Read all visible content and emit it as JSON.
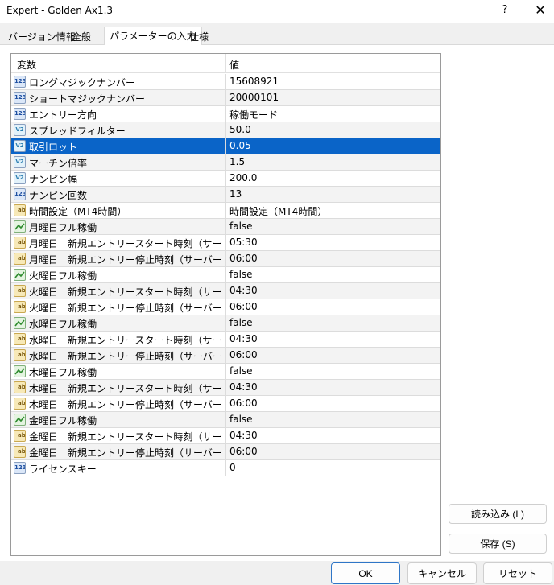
{
  "window": {
    "title": "Expert - Golden Ax1.3",
    "help_glyph": "?",
    "close_glyph": "✕"
  },
  "tabs": [
    {
      "label": "バージョン情報",
      "active": false
    },
    {
      "label": "全般",
      "active": false
    },
    {
      "label": "パラメーターの入力",
      "active": true
    },
    {
      "label": "仕様",
      "active": false
    }
  ],
  "grid": {
    "col_variable": "変数",
    "col_value": "値",
    "rows": [
      {
        "type": "123",
        "name": "ロングマジックナンバー",
        "value": "15608921"
      },
      {
        "type": "123",
        "name": "ショートマジックナンバー",
        "value": "20000101"
      },
      {
        "type": "123",
        "name": "エントリー方向",
        "value": "稼働モード"
      },
      {
        "type": "v2",
        "name": "スプレッドフィルター",
        "value": "50.0"
      },
      {
        "type": "v2",
        "name": "取引ロット",
        "value": "0.05",
        "selected": true
      },
      {
        "type": "v2",
        "name": "マーチン倍率",
        "value": "1.5"
      },
      {
        "type": "v2",
        "name": "ナンピン幅",
        "value": "200.0"
      },
      {
        "type": "123",
        "name": "ナンピン回数",
        "value": "13"
      },
      {
        "type": "ab",
        "name": "時間設定（MT4時間）",
        "value": "時間設定（MT4時間）"
      },
      {
        "type": "bool",
        "name": "月曜日フル稼働",
        "value": "false"
      },
      {
        "type": "ab",
        "name": "月曜日　新規エントリースタート時刻（サーバー時…",
        "value": "05:30"
      },
      {
        "type": "ab",
        "name": "月曜日　新規エントリー停止時刻（サーバー時…",
        "value": "06:00"
      },
      {
        "type": "bool",
        "name": "火曜日フル稼働",
        "value": "false"
      },
      {
        "type": "ab",
        "name": "火曜日　新規エントリースタート時刻（サーバー時…",
        "value": "04:30"
      },
      {
        "type": "ab",
        "name": "火曜日　新規エントリー停止時刻（サーバー時…",
        "value": "06:00"
      },
      {
        "type": "bool",
        "name": "水曜日フル稼働",
        "value": "false"
      },
      {
        "type": "ab",
        "name": "水曜日　新規エントリースタート時刻（サーバー時…",
        "value": "04:30"
      },
      {
        "type": "ab",
        "name": "水曜日　新規エントリー停止時刻（サーバー時…",
        "value": "06:00"
      },
      {
        "type": "bool",
        "name": "木曜日フル稼働",
        "value": "false"
      },
      {
        "type": "ab",
        "name": "木曜日　新規エントリースタート時刻（サーバー時…",
        "value": "04:30"
      },
      {
        "type": "ab",
        "name": "木曜日　新規エントリー停止時刻（サーバー時…",
        "value": "06:00"
      },
      {
        "type": "bool",
        "name": "金曜日フル稼働",
        "value": "false"
      },
      {
        "type": "ab",
        "name": "金曜日　新規エントリースタート時刻（サーバー時…",
        "value": "04:30"
      },
      {
        "type": "ab",
        "name": "金曜日　新規エントリー停止時刻（サーバー時…",
        "value": "06:00"
      },
      {
        "type": "123",
        "name": "ライセンスキー",
        "value": "0"
      }
    ]
  },
  "icon_labels": {
    "t123": "123",
    "tv2": "V2",
    "tab": "ab"
  },
  "buttons": {
    "load": "読み込み (L)",
    "save": "保存 (S)",
    "ok": "OK",
    "cancel": "キャンセル",
    "reset": "リセット"
  },
  "colors": {
    "selection": "#0a64c8",
    "ok_border": "#2f76c7"
  }
}
